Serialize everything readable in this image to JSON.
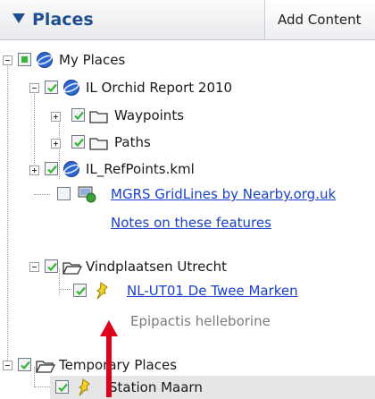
{
  "header": {
    "title": "Places",
    "add_content_label": "Add Content"
  },
  "tree": {
    "my_places": "My Places",
    "il_orchid_report": "IL Orchid Report 2010",
    "waypoints": "Waypoints",
    "paths": "Paths",
    "il_refpoints": "IL_RefPoints.kml",
    "mgrs_gridlines": "MGRS GridLines by Nearby.org.uk",
    "notes_link": "Notes on these features",
    "vindplaatsen": "Vindplaatsen Utrecht",
    "nl_ut01": "NL-UT01 De Twee Marken",
    "nl_ut01_description": "Epipactis helleborine",
    "temporary_places": "Temporary Places",
    "station_maarn": "Station Maarn"
  },
  "colors": {
    "link": "#1a3fcc",
    "check": "#36b43a",
    "accent": "#1f4f92",
    "annotation_arrow": "#e0001b"
  }
}
